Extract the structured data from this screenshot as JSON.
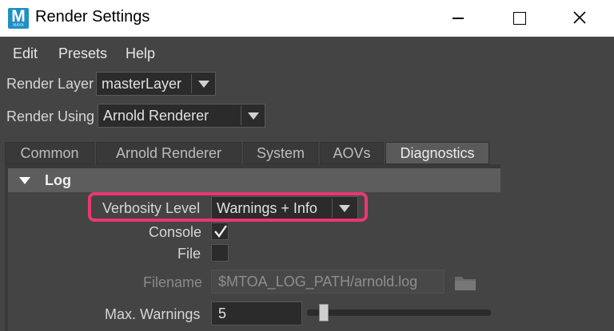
{
  "window": {
    "title": "Render Settings",
    "app_icon_letter": "M",
    "app_icon_sub": "MAYA"
  },
  "menu": [
    "Edit",
    "Presets",
    "Help"
  ],
  "render_layer": {
    "label": "Render Layer",
    "value": "masterLayer"
  },
  "render_using": {
    "label": "Render Using",
    "value": "Arnold Renderer"
  },
  "tabs": [
    {
      "label": "Common",
      "active": false
    },
    {
      "label": "Arnold Renderer",
      "active": false
    },
    {
      "label": "System",
      "active": false
    },
    {
      "label": "AOVs",
      "active": false
    },
    {
      "label": "Diagnostics",
      "active": true
    }
  ],
  "log": {
    "section_title": "Log",
    "verbosity": {
      "label": "Verbosity Level",
      "value": "Warnings + Info"
    },
    "console": {
      "label": "Console",
      "checked": true
    },
    "file": {
      "label": "File",
      "checked": false
    },
    "filename": {
      "label": "Filename",
      "value": "$MTOA_LOG_PATH/arnold.log"
    },
    "max_warnings": {
      "label": "Max. Warnings",
      "value": "5",
      "slider_fraction": 0.05
    }
  },
  "colors": {
    "highlight": "#e8386f",
    "background": "#444444",
    "field": "#2b2b2b"
  }
}
